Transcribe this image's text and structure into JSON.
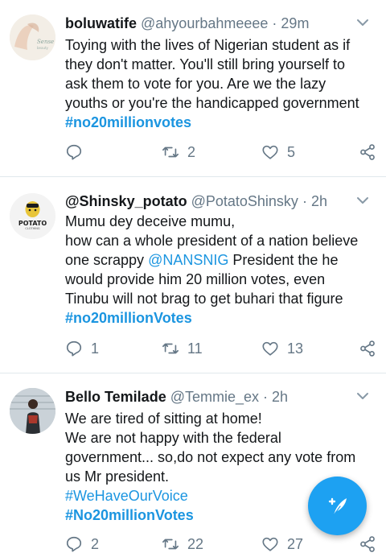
{
  "tweets": [
    {
      "name": "boluwatife",
      "handle": "@ahyourbahmeeee",
      "time": "· 29m",
      "lines": [
        "Toying with the lives of Nigerian student as if",
        "they don't matter. You'll still bring yourself to",
        "ask them to vote for you. Are we the lazy",
        "youths or you're the handicapped government"
      ],
      "hashtags": [
        "#no20millionvotes"
      ],
      "replies": "",
      "retweets": "2",
      "likes": "5"
    },
    {
      "name": "@Shinsky_potato",
      "handle": "@PotatoShinsky",
      "time": "· 2h",
      "avatar_text": "POTATO",
      "avatar_subtext": "CLOTHING",
      "line1": "Mumu dey deceive mumu,",
      "line2": "how can a whole president of a nation believe",
      "line3_pre": "one scrappy ",
      "line3_mention": "@NANSNIG",
      "line3_post": " President the he",
      "line4": "would provide him 20 million votes,  even",
      "line5": "Tinubu will not brag to get buhari that figure",
      "hashtags": [
        "#no20millionVotes"
      ],
      "replies": "1",
      "retweets": "11",
      "likes": "13"
    },
    {
      "name": "Bello Temilade",
      "handle": "@Temmie_ex",
      "time": "· 2h",
      "lines": [
        "We are tired of sitting at home!",
        "We are not happy with the federal",
        "government... so,do not expect any vote from",
        "us Mr president."
      ],
      "hashtags": [
        "#WeHaveOurVoice",
        "#No20millionVotes"
      ],
      "replies": "2",
      "retweets": "22",
      "likes": "27"
    }
  ],
  "colors": {
    "link": "#1b95e0",
    "muted": "#657786",
    "fab": "#1da1f2"
  },
  "icons": [
    "reply-icon",
    "retweet-icon",
    "like-icon",
    "share-icon",
    "caret-down-icon",
    "compose-icon"
  ]
}
